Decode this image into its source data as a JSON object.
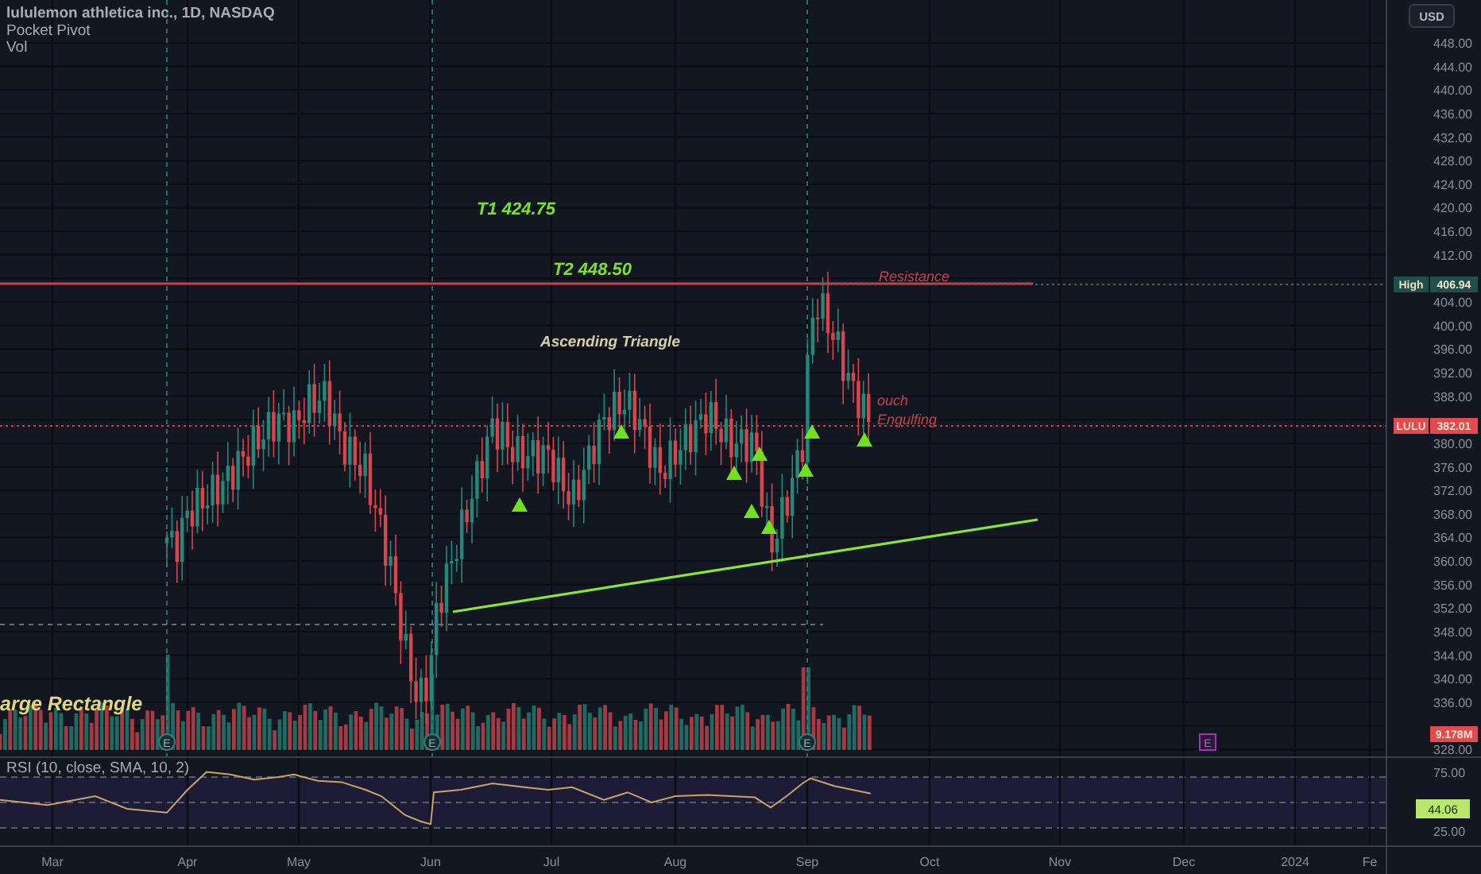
{
  "legend": {
    "symbol": "lululemon athletica inc., 1D, NASDAQ",
    "indicators": [
      "Pocket Pivot",
      "Vol"
    ]
  },
  "currency_button": "USD",
  "price_axis": [
    "448.00",
    "444.00",
    "440.00",
    "436.00",
    "432.00",
    "428.00",
    "424.00",
    "420.00",
    "416.00",
    "412.00",
    "404.00",
    "400.00",
    "396.00",
    "392.00",
    "388.00",
    "380.00",
    "376.00",
    "372.00",
    "368.00",
    "364.00",
    "360.00",
    "356.00",
    "352.00",
    "348.00",
    "344.00",
    "340.00",
    "336.00",
    "328.00"
  ],
  "price_tags": [
    {
      "title": "High",
      "value": "406.94",
      "color": "#1f4e4b"
    },
    {
      "title": "LULU",
      "value": "382.01",
      "color": "#e5484d"
    },
    {
      "value": "9.178M",
      "color": "#e5484d"
    }
  ],
  "annotations": [
    {
      "text": "T1 424.75",
      "kind": "target"
    },
    {
      "text": "T2 448.50",
      "kind": "target"
    },
    {
      "text": "Resistance",
      "kind": "resistance"
    },
    {
      "text": "Ascending Triangle",
      "kind": "pattern"
    },
    {
      "text": "ouch",
      "kind": "resistance"
    },
    {
      "text": "Engulfing",
      "kind": "resistance"
    },
    {
      "text": "arge Rectangle",
      "kind": "pattern-large"
    }
  ],
  "earnings_markers": [
    {
      "label": "E",
      "upcoming": false
    },
    {
      "label": "E",
      "upcoming": false
    },
    {
      "label": "E",
      "upcoming": false
    },
    {
      "label": "E",
      "upcoming": true
    }
  ],
  "rsi": {
    "legend": "RSI (10, close, SMA, 10, 2)",
    "axis_labels": [
      "75.00",
      "25.00"
    ],
    "value_tag": "44.06"
  },
  "time_axis": [
    "Mar",
    "Apr",
    "May",
    "Jun",
    "Jul",
    "Aug",
    "Sep",
    "Oct",
    "Nov",
    "Dec",
    "2024",
    "Fe"
  ]
}
